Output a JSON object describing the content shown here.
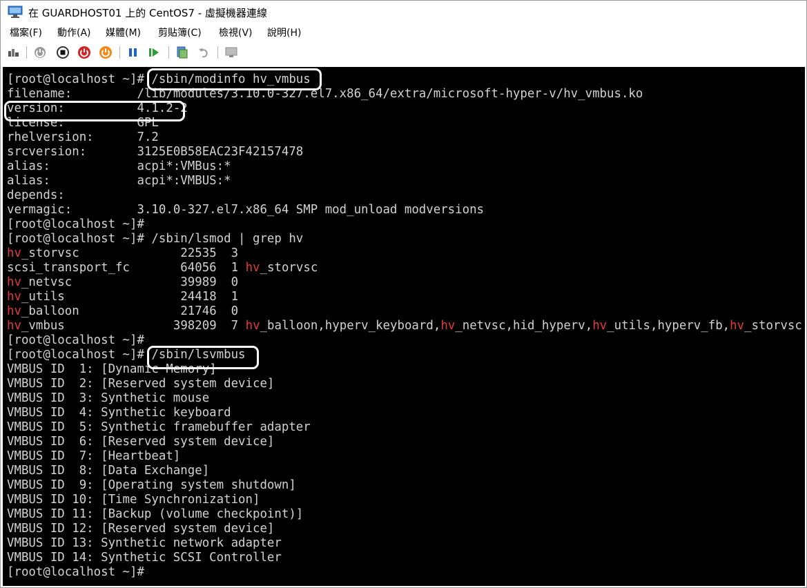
{
  "window": {
    "title": "在 GUARDHOST01 上的 CentOS7 - 虛擬機器連線"
  },
  "menu": [
    {
      "label": "檔案(F)"
    },
    {
      "label": "動作(A)"
    },
    {
      "label": "媒體(M)"
    },
    {
      "label": "剪貼簿(C)"
    },
    {
      "label": "檢視(V)"
    },
    {
      "label": "說明(H)"
    }
  ],
  "toolbar": {
    "icons": [
      "ctrl-alt-del-icon",
      "start-icon",
      "turn-off-icon",
      "shut-down-icon",
      "save-icon",
      "pause-icon",
      "resume-icon",
      "checkpoint-icon",
      "revert-icon",
      "enhanced-session-icon"
    ]
  },
  "colors": {
    "terminal_bg": "#000000",
    "terminal_fg": "#d2d2d2",
    "module_highlight": "#e23a3a",
    "annotation_box": "#ffffff"
  },
  "terminal": {
    "modinfo": {
      "prompt": "[root@localhost ~]# ",
      "command": "/sbin/modinfo hv_vmbus",
      "fields": [
        {
          "key": "filename:",
          "value": "/lib/modules/3.10.0-327.el7.x86_64/extra/microsoft-hyper-v/hv_vmbus.ko"
        },
        {
          "key": "version:",
          "value": "4.1.2-2"
        },
        {
          "key": "license:",
          "value": "GPL"
        },
        {
          "key": "rhelversion:",
          "value": "7.2"
        },
        {
          "key": "srcversion:",
          "value": "3125E0B58EAC23F42157478"
        },
        {
          "key": "alias:",
          "value": "acpi*:VMBus:*"
        },
        {
          "key": "alias:",
          "value": "acpi*:VMBUS:*"
        },
        {
          "key": "depends:",
          "value": ""
        },
        {
          "key": "vermagic:",
          "value": "3.10.0-327.el7.x86_64 SMP mod_unload modversions"
        }
      ]
    },
    "prompt_empty_1": "[root@localhost ~]#",
    "lsmod": {
      "prompt": "[root@localhost ~]# ",
      "command": "/sbin/lsmod | grep hv",
      "rows": [
        {
          "prefix": "hv",
          "rest": "_storvsc",
          "size": "22535",
          "used": "3",
          "by": []
        },
        {
          "prefix": "",
          "rest": "scsi_transport_fc",
          "size": "64056",
          "used": "1",
          "by": [
            {
              "hl": "hv",
              "rest": "_storvsc"
            }
          ]
        },
        {
          "prefix": "hv",
          "rest": "_netvsc",
          "size": "39989",
          "used": "0",
          "by": []
        },
        {
          "prefix": "hv",
          "rest": "_utils",
          "size": "24418",
          "used": "1",
          "by": []
        },
        {
          "prefix": "hv",
          "rest": "_balloon",
          "size": "21746",
          "used": "0",
          "by": []
        },
        {
          "prefix": "hv",
          "rest": "_vmbus",
          "size": "398209",
          "used": "7",
          "by": [
            {
              "hl": "hv",
              "rest": "_balloon,"
            },
            {
              "hl": "",
              "rest": "hyperv_keyboard,"
            },
            {
              "hl": "hv",
              "rest": "_netvsc,"
            },
            {
              "hl": "",
              "rest": "hid_hyperv,"
            },
            {
              "hl": "hv",
              "rest": "_utils,"
            },
            {
              "hl": "",
              "rest": "hyperv_fb,"
            },
            {
              "hl": "hv",
              "rest": "_storvsc"
            }
          ]
        }
      ]
    },
    "prompt_empty_2": "[root@localhost ~]#",
    "lsvmbus": {
      "prompt": "[root@localhost ~]# ",
      "command": "/sbin/lsvmbus",
      "rows": [
        "VMBUS ID  1: [Dynamic Memory]",
        "VMBUS ID  2: [Reserved system device]",
        "VMBUS ID  3: Synthetic mouse",
        "VMBUS ID  4: Synthetic keyboard",
        "VMBUS ID  5: Synthetic framebuffer adapter",
        "VMBUS ID  6: [Reserved system device]",
        "VMBUS ID  7: [Heartbeat]",
        "VMBUS ID  8: [Data Exchange]",
        "VMBUS ID  9: [Operating system shutdown]",
        "VMBUS ID 10: [Time Synchronization]",
        "VMBUS ID 11: [Backup (volume checkpoint)]",
        "VMBUS ID 12: [Reserved system device]",
        "VMBUS ID 13: Synthetic network adapter",
        "VMBUS ID 14: Synthetic SCSI Controller"
      ]
    },
    "prompt_final": "[root@localhost ~]#"
  }
}
